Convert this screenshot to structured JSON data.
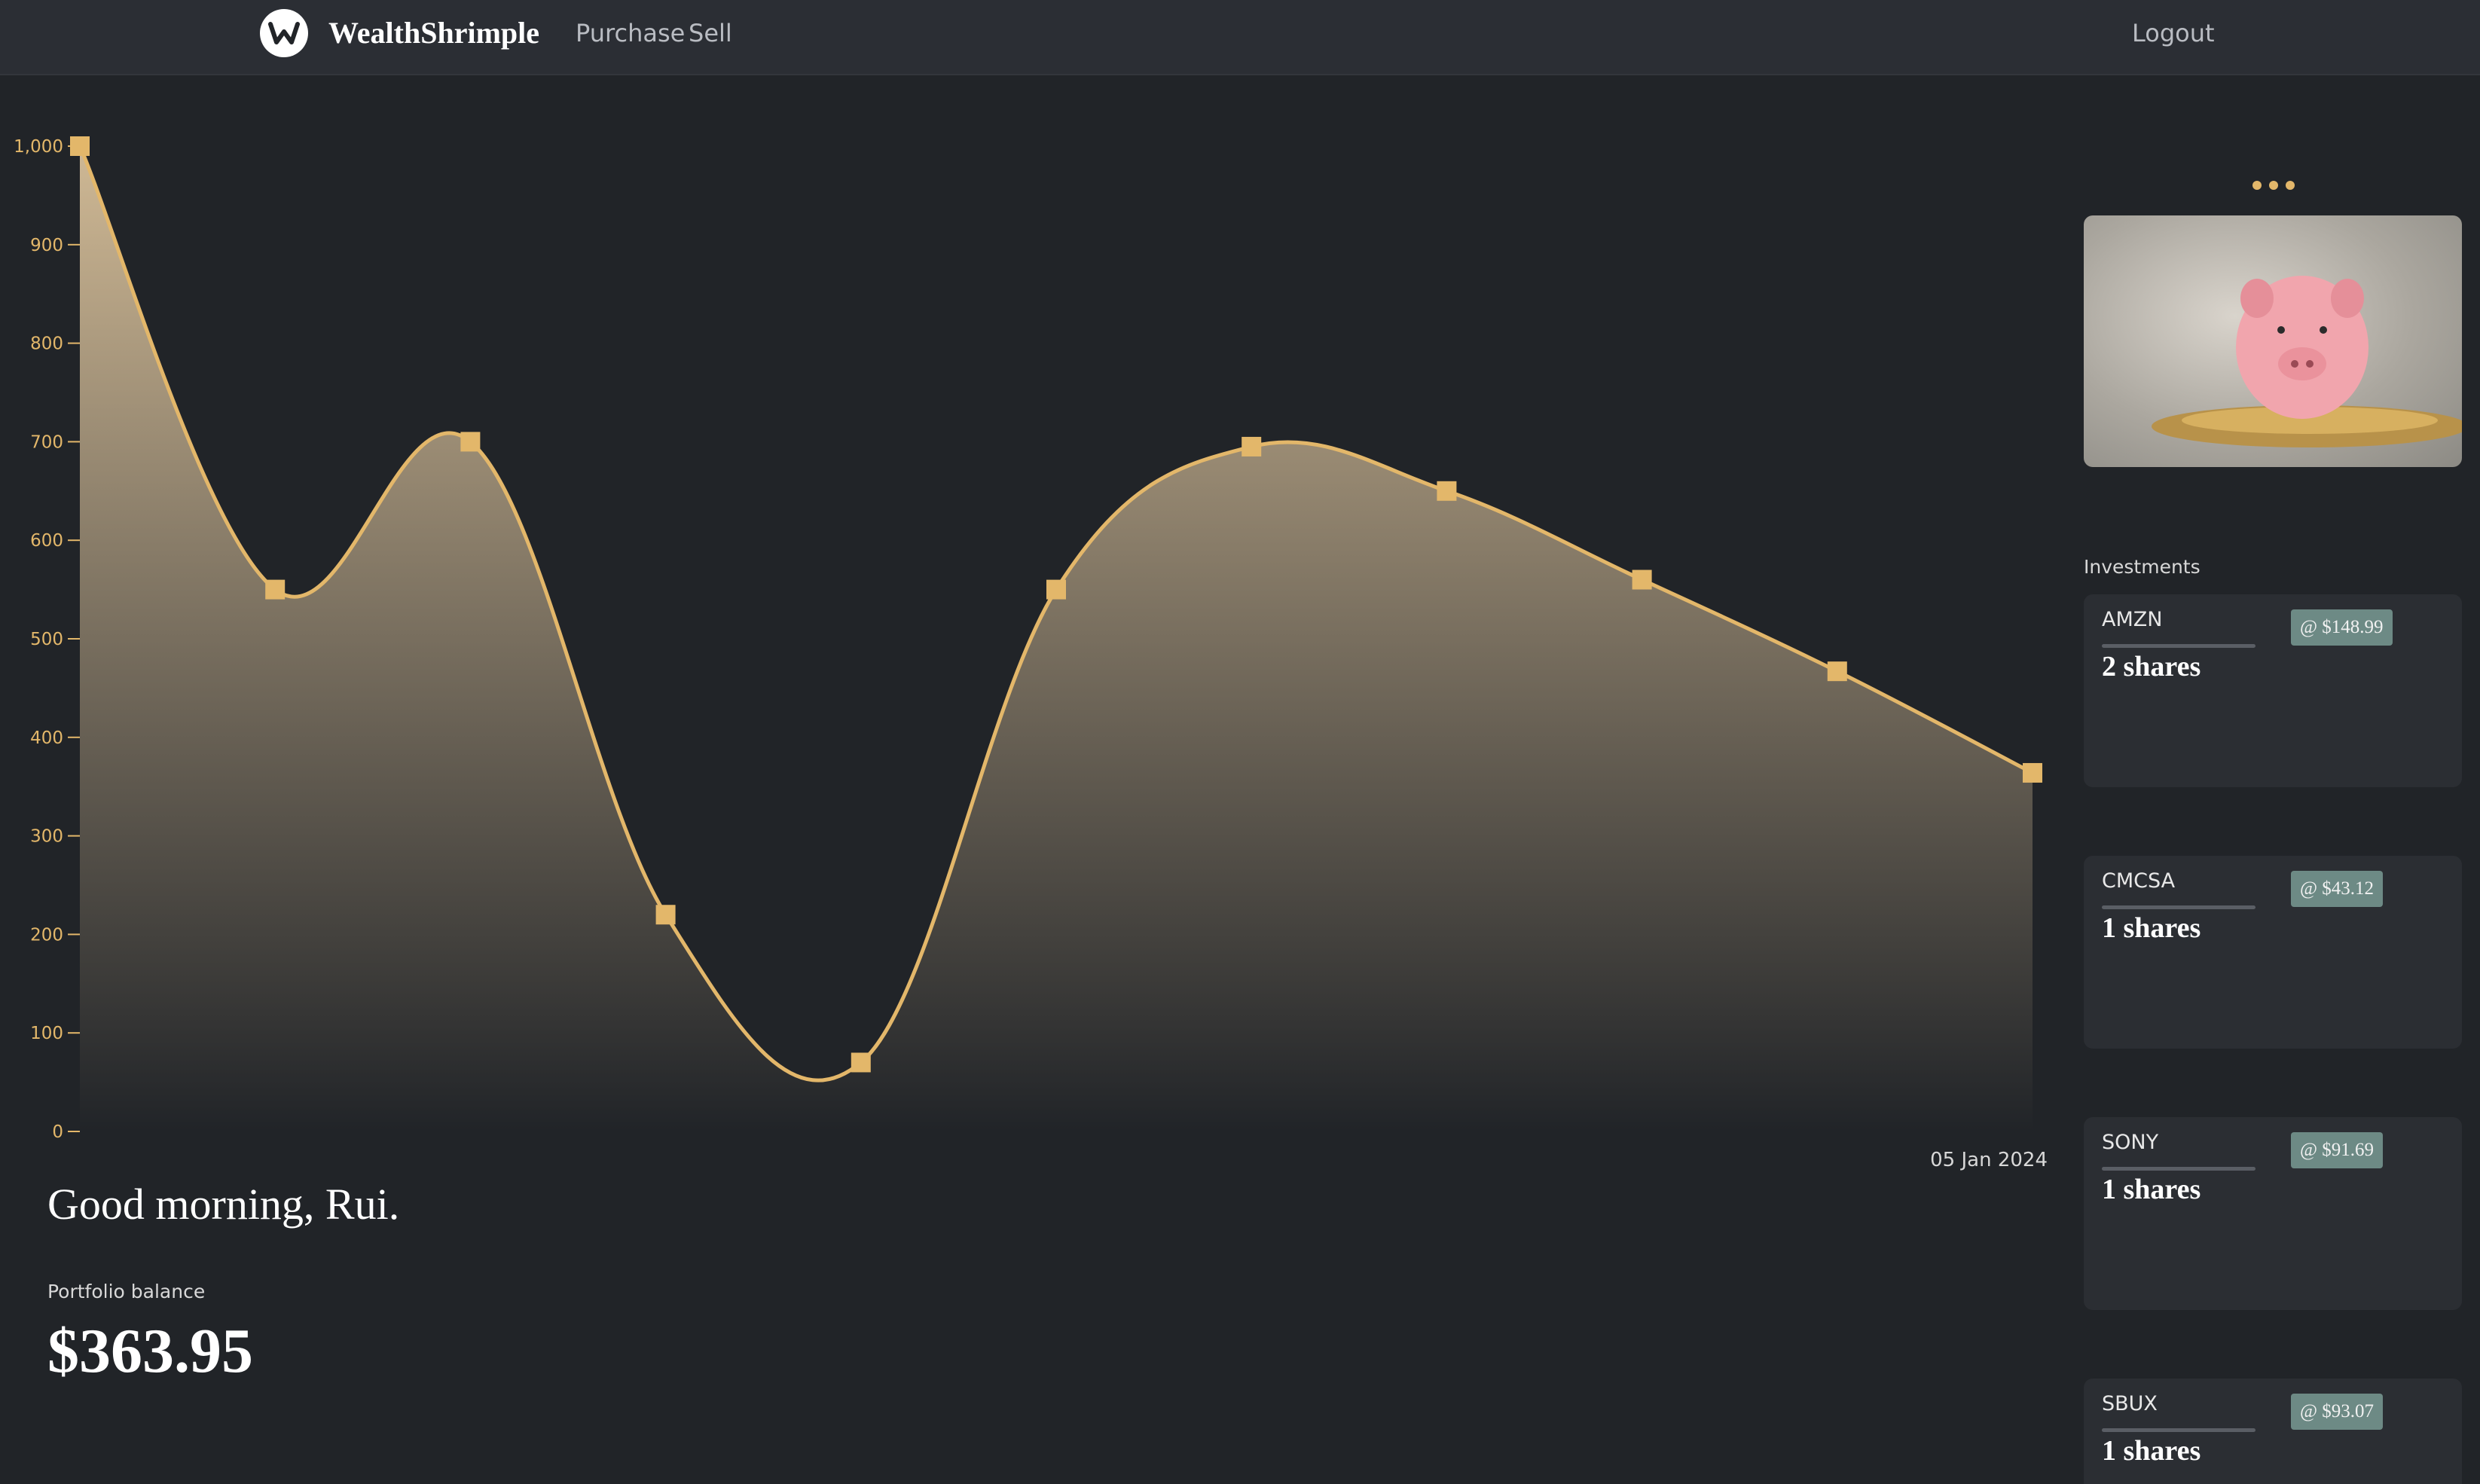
{
  "app": {
    "name": "WealthShrimple",
    "nav": [
      "Purchase",
      "Sell"
    ],
    "logout_label": "Logout"
  },
  "chart_data": {
    "type": "area",
    "y": [
      1000,
      550,
      700,
      220,
      70,
      550,
      695,
      650,
      560,
      467,
      363.95
    ],
    "yticks": [
      "0",
      "100",
      "200",
      "300",
      "400",
      "500",
      "600",
      "700",
      "800",
      "900",
      "1,000"
    ],
    "ylim": [
      0,
      1000
    ],
    "x_end_label": "05 Jan 2024",
    "line_color": "#e3b76a",
    "fill_top_color": "#d8c09a",
    "grid": false
  },
  "greeting": "Good morning, Rui.",
  "portfolio": {
    "balance_label": "Portfolio balance",
    "balance_value": "$363.95"
  },
  "sidebar": {
    "more_icon": "ellipsis-icon",
    "image": "piggy-bank-photo",
    "investments_label": "Investments",
    "investments": [
      {
        "ticker": "AMZN",
        "shares": "2 shares",
        "price": "@ $148.99"
      },
      {
        "ticker": "CMCSA",
        "shares": "1 shares",
        "price": "@ $43.12"
      },
      {
        "ticker": "SONY",
        "shares": "1 shares",
        "price": "@ $91.69"
      },
      {
        "ticker": "SBUX",
        "shares": "1 shares",
        "price": "@ $93.07"
      }
    ]
  },
  "colors": {
    "accent": "#e3b76a",
    "background": "#212428",
    "card": "#2b2e33",
    "badge": "#6d8a85"
  }
}
